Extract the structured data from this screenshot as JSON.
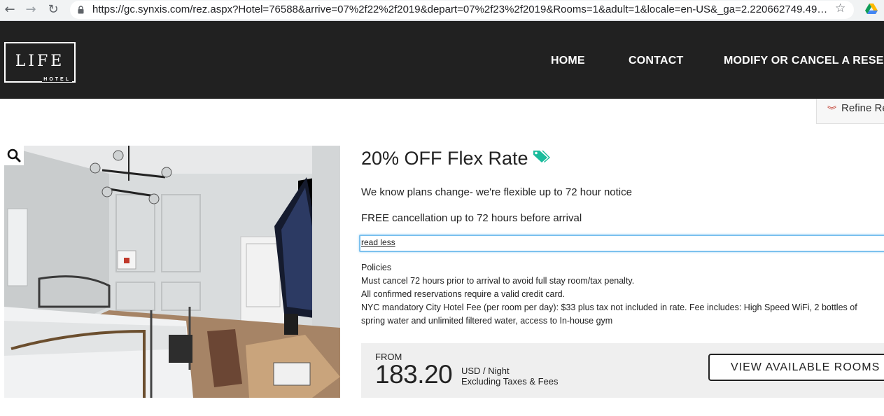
{
  "browser": {
    "url": "https://gc.synxis.com/rez.aspx?Hotel=76588&arrive=07%2f22%2f2019&depart=07%2f23%2f2019&Rooms=1&adult=1&locale=en-US&_ga=2.220662749.49…"
  },
  "header": {
    "logo_main": "LIFE",
    "logo_sub": "HOTEL",
    "nav": [
      {
        "label": "HOME"
      },
      {
        "label": "CONTACT"
      },
      {
        "label": "MODIFY OR CANCEL A RESERVA"
      }
    ]
  },
  "refine": {
    "label": "Refine Re",
    "icon": "chevron-double-down-icon",
    "icon_color": "#c0392b"
  },
  "rate": {
    "title": "20% OFF Flex Rate",
    "tag_color": "#1abc9c",
    "desc1": "We know plans change- we're flexible up to 72 hour notice",
    "desc2": "FREE cancellation up to 72 hours before arrival",
    "read_less": "read less",
    "policies": [
      "Policies",
      "Must cancel 72 hours prior to arrival to avoid full stay room/tax penalty.",
      "All confirmed reservations require a valid credit card.",
      "NYC mandatory City Hotel Fee (per room per day): $33 plus tax not included in rate. Fee includes: High Speed WiFi, 2 bottles of spring water and unlimited filtered water, access to In-house gym"
    ]
  },
  "price": {
    "from": "FROM",
    "amount": "183.20",
    "unit": "USD / Night",
    "note": "Excluding Taxes & Fees",
    "button": "VIEW AVAILABLE ROOMS"
  }
}
